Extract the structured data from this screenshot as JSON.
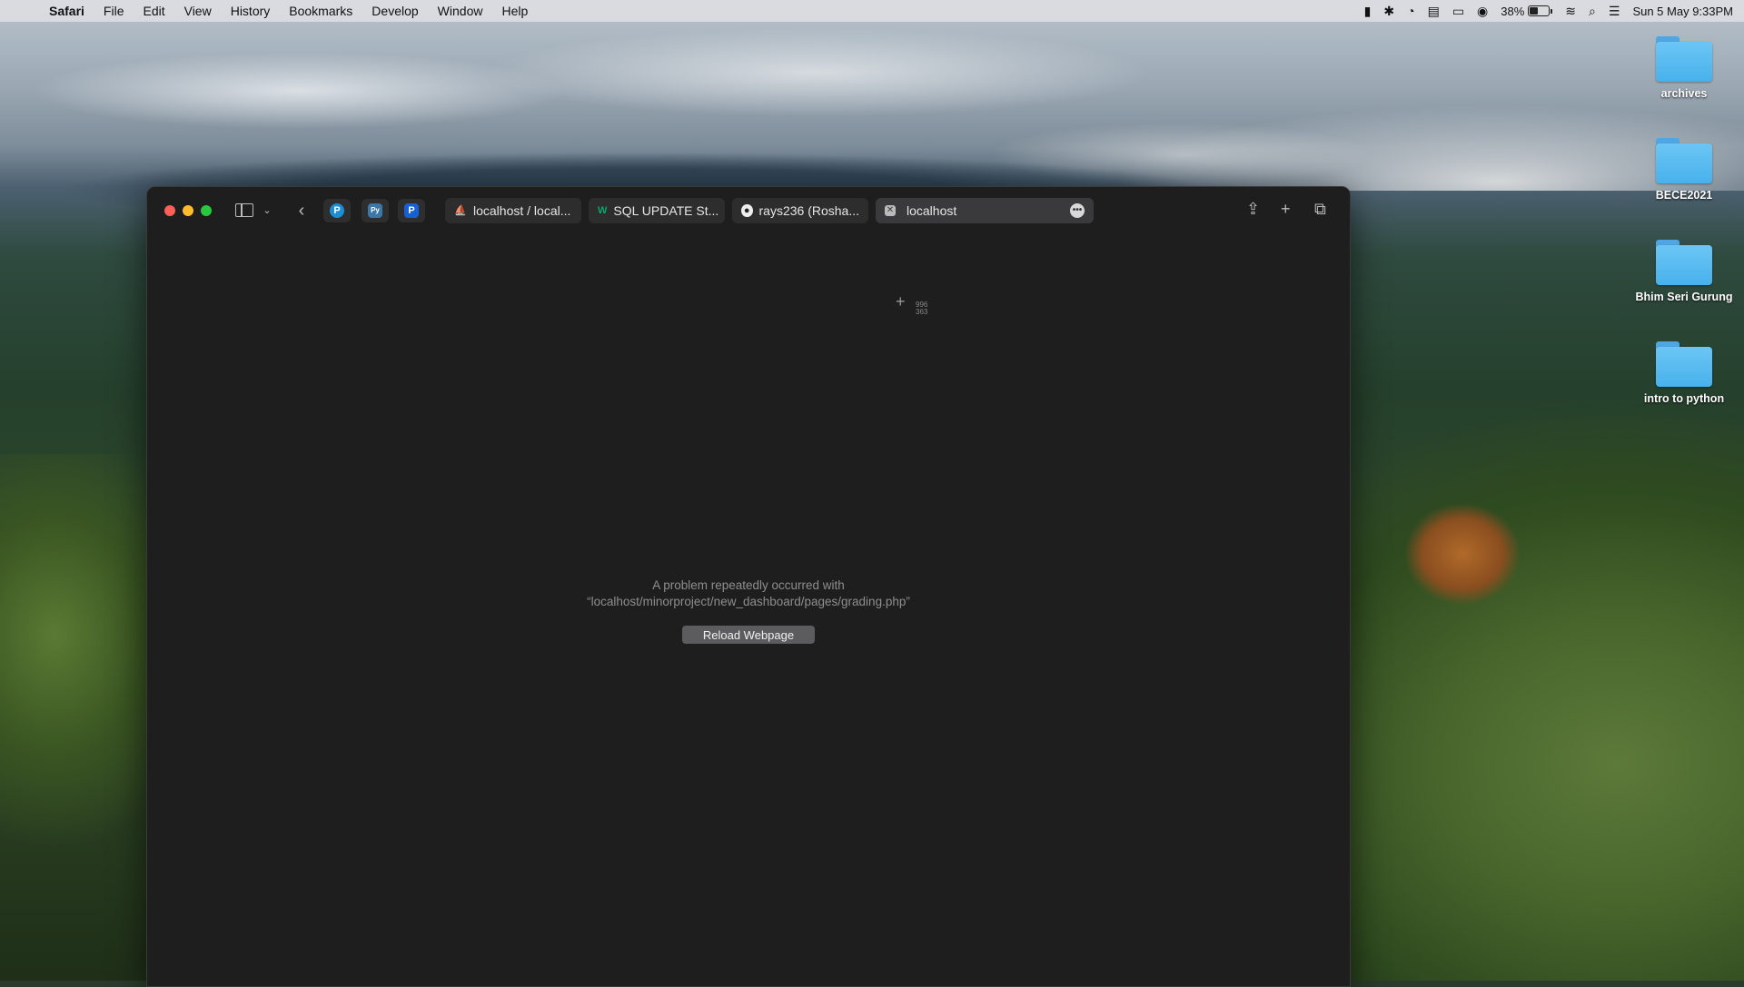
{
  "menubar": {
    "apple": "",
    "app_name": "Safari",
    "items": [
      "File",
      "Edit",
      "View",
      "History",
      "Bookmarks",
      "Develop",
      "Window",
      "Help"
    ],
    "battery_percent": "38%",
    "battery_level": 0.38,
    "datetime": "Sun 5 May  9:33PM"
  },
  "desktop": {
    "folders": [
      {
        "label": "archives"
      },
      {
        "label": "BECE2021"
      },
      {
        "label": "Bhim Seri Gurung"
      },
      {
        "label": "intro to python"
      }
    ]
  },
  "browser": {
    "pinned_tabs": [
      {
        "icon": "p-circle-icon",
        "letter": "P",
        "color": "#1a8fd8"
      },
      {
        "icon": "python-icon",
        "letter": "Py",
        "color": "#3b77a8"
      },
      {
        "icon": "p-square-icon",
        "letter": "P",
        "color": "#1560d4"
      }
    ],
    "tabs": [
      {
        "label": "localhost / local...",
        "icon": "phpmyadmin-icon"
      },
      {
        "label": "SQL UPDATE St...",
        "icon": "w3schools-icon"
      },
      {
        "label": "rays236 (Rosha...",
        "icon": "github-icon"
      }
    ],
    "active_tab": {
      "label": "localhost",
      "icon": "close-icon"
    },
    "content": {
      "cursor_coords_line1": "996",
      "cursor_coords_line2": "363",
      "error_line1": "A problem repeatedly occurred with",
      "error_line2": "“localhost/minorproject/new_dashboard/pages/grading.php”",
      "reload_label": "Reload Webpage"
    }
  }
}
